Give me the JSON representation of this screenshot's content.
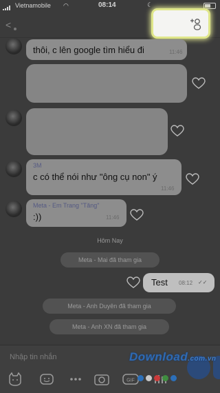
{
  "status_bar": {
    "carrier": "Vietnamobile",
    "time": "08:14"
  },
  "messages": [
    {
      "sender": "",
      "text": "thôi, c lên google tìm hiểu đi",
      "time": "11:46"
    },
    {
      "sender": "3M",
      "text": "c có thể nói như \"ông cụ non\" ý",
      "time": "11:46"
    },
    {
      "sender": "Meta - Em Trang \"Tăng\"",
      "text": ":))",
      "time": "11:46"
    }
  ],
  "day_separator": "Hôm Nay",
  "system_messages": [
    "Meta - Mai đã tham gia",
    "Meta - Anh Duyên đã tham gia",
    "Meta - Anh XN đã tham gia"
  ],
  "my_message": {
    "text": "Test",
    "time": "08:12"
  },
  "composer": {
    "placeholder": "Nhập tin nhắn"
  },
  "watermark": {
    "text": "Download",
    "suffix": ".com.vn"
  },
  "colors": {
    "highlight": "#f0f59a",
    "sender_name": "#555a83",
    "watermark": "#2f6ab3"
  },
  "icons": [
    "back-arrow-icon",
    "add-member-icon",
    "heart-icon",
    "sticker-icon",
    "emoji-icon",
    "more-icon",
    "camera-icon",
    "gif-icon",
    "image-icon",
    "voice-icon"
  ]
}
